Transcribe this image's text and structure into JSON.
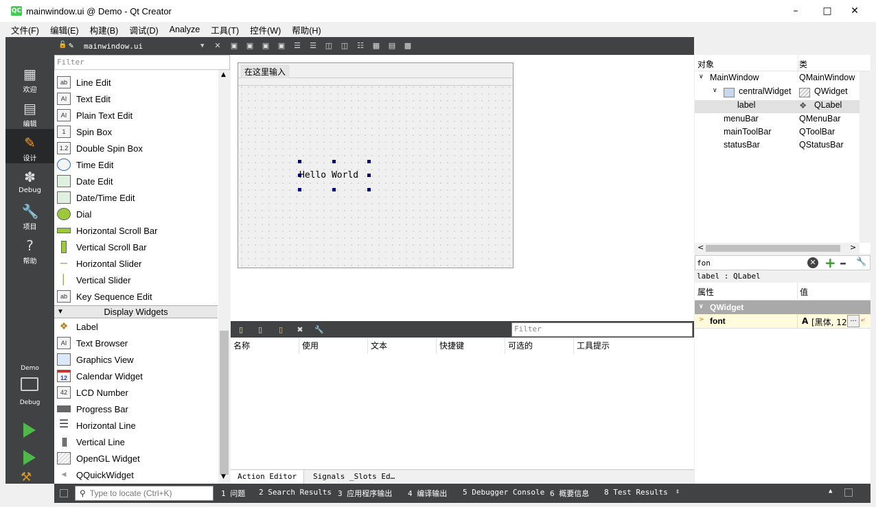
{
  "window": {
    "title": "mainwindow.ui @ Demo - Qt Creator",
    "app_icon": "QC"
  },
  "menu": [
    "文件(F)",
    "编辑(E)",
    "构建(B)",
    "调试(D)",
    "Analyze",
    "工具(T)",
    "控件(W)",
    "帮助(H)"
  ],
  "modes": [
    {
      "label": "欢迎",
      "icon": "grid-icon"
    },
    {
      "label": "编辑",
      "icon": "document-icon"
    },
    {
      "label": "设计",
      "icon": "pencil-icon"
    },
    {
      "label": "Debug",
      "icon": "bug-icon"
    },
    {
      "label": "项目",
      "icon": "wrench-icon"
    },
    {
      "label": "帮助",
      "icon": "help-icon"
    }
  ],
  "target": {
    "project": "Demo",
    "config": "Debug"
  },
  "editor": {
    "file": "mainwindow.ui"
  },
  "widgetbox": {
    "filter_placeholder": "Filter",
    "items": [
      "Line Edit",
      "Text Edit",
      "Plain Text Edit",
      "Spin Box",
      "Double Spin Box",
      "Time Edit",
      "Date Edit",
      "Date/Time Edit",
      "Dial",
      "Horizontal Scroll Bar",
      "Vertical Scroll Bar",
      "Horizontal Slider",
      "Vertical Slider",
      "Key Sequence Edit"
    ],
    "category": "Display Widgets",
    "display_items": [
      "Label",
      "Text Browser",
      "Graphics View",
      "Calendar Widget",
      "LCD Number",
      "Progress Bar",
      "Horizontal Line",
      "Vertical Line",
      "OpenGL Widget",
      "QQuickWidget"
    ]
  },
  "form": {
    "menu_placeholder": "在这里输入",
    "label_text": "Hello World"
  },
  "action_editor": {
    "filter_placeholder": "Filter",
    "columns": [
      "名称",
      "使用",
      "文本",
      "快捷键",
      "可选的",
      "工具提示"
    ],
    "tabs": [
      "Action Editor",
      "Signals _Slots Ed…"
    ]
  },
  "object_inspector": {
    "col_object": "对象",
    "col_class": "类",
    "rows": [
      {
        "name": "MainWindow",
        "cls": "QMainWindow"
      },
      {
        "name": "centralWidget",
        "cls": "QWidget"
      },
      {
        "name": "label",
        "cls": "QLabel"
      },
      {
        "name": "menuBar",
        "cls": "QMenuBar"
      },
      {
        "name": "mainToolBar",
        "cls": "QToolBar"
      },
      {
        "name": "statusBar",
        "cls": "QStatusBar"
      }
    ]
  },
  "property_editor": {
    "filter_value": "fon",
    "object_class": "label : QLabel",
    "col_property": "属性",
    "col_value": "值",
    "group": "QWidget",
    "prop_name": "font",
    "prop_value": "[黑体, 12]",
    "prop_more": "..."
  },
  "statusbar": {
    "locate_placeholder": "Type to locate (Ctrl+K)",
    "items": [
      "1 问题",
      "2 Search Results",
      "3 应用程序输出",
      "4 编译输出",
      "5 Debugger Console",
      "6 概要信息",
      "8 Test Results"
    ]
  }
}
